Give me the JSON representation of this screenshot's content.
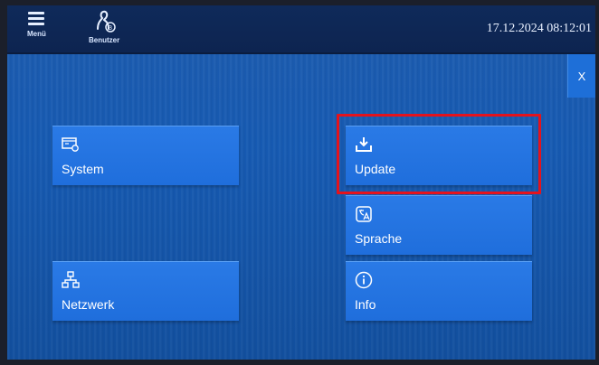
{
  "topbar": {
    "menu_label": "Menü",
    "user_label": "Benutzer",
    "user_badge": "3",
    "datetime": "17.12.2024 08:12:01"
  },
  "close_label": "X",
  "tiles": {
    "system": "System",
    "update": "Update",
    "sprache": "Sprache",
    "netzwerk": "Netzwerk",
    "info": "Info"
  },
  "colors": {
    "background": "#165ab2",
    "topbar": "#0f2a5a",
    "tile": "#2a7ae6",
    "highlight": "#e3131d"
  },
  "icons": {
    "menu": "hamburger-icon",
    "user": "user-icon",
    "system": "system-icon",
    "update": "download-icon",
    "sprache": "translate-icon",
    "netzwerk": "network-icon",
    "info": "info-icon"
  }
}
